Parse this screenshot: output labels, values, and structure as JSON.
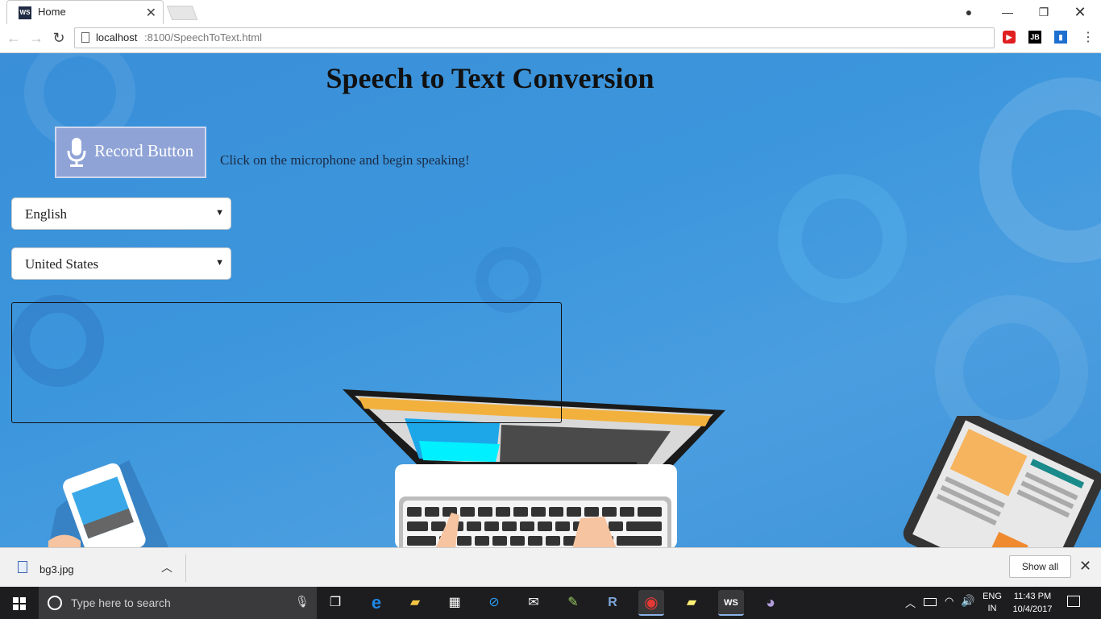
{
  "browser": {
    "tab_title": "Home",
    "tab_favicon_text": "WS",
    "tab_close": "✕",
    "url_host": "localhost",
    "url_path": ":8100/SpeechToText.html",
    "extensions": {
      "red_label": "▶",
      "jb_label": "JB",
      "blue_label": "▮"
    },
    "menu_glyph": "⋮",
    "window_controls": {
      "profile": "●",
      "minimize": "—",
      "maximize": "❐",
      "close": "✕"
    }
  },
  "page": {
    "title": "Speech to Text Conversion",
    "record_button_label": "Record Button",
    "instruction": "Click on the microphone and begin speaking!",
    "language_select": {
      "value": "English",
      "arrow": "▼"
    },
    "dialect_select": {
      "value": "United States",
      "arrow": "▼"
    },
    "transcript": ""
  },
  "download_bar": {
    "filename": "bg3.jpg",
    "chevron": "︿",
    "show_all_label": "Show all",
    "close_glyph": "✕"
  },
  "taskbar": {
    "search_placeholder": "Type here to search",
    "mic_glyph": "🎙",
    "apps": [
      {
        "name": "task-view",
        "glyph": "❐",
        "color": "#ffffff"
      },
      {
        "name": "edge",
        "glyph": "e",
        "color": "#1e88e5"
      },
      {
        "name": "file-explorer",
        "glyph": "▰",
        "color": "#f4c542"
      },
      {
        "name": "store",
        "glyph": "▦",
        "color": "#ffffff"
      },
      {
        "name": "safari",
        "glyph": "⊘",
        "color": "#2d9bf0"
      },
      {
        "name": "mail",
        "glyph": "✉",
        "color": "#ffffff"
      },
      {
        "name": "notepad-plus",
        "glyph": "✎",
        "color": "#9ccc65"
      },
      {
        "name": "r-studio",
        "glyph": "R",
        "color": "#7da7d9"
      },
      {
        "name": "chrome",
        "glyph": "◉",
        "color": "#e53935"
      },
      {
        "name": "sticky-notes",
        "glyph": "▰",
        "color": "#fff176"
      },
      {
        "name": "webstorm",
        "glyph": "WS",
        "color": "#ffffff"
      },
      {
        "name": "github-desktop",
        "glyph": "◕",
        "color": "#ffffff"
      }
    ],
    "tray": {
      "chevron": "︿",
      "wifi": "◠",
      "volume": "🔊"
    },
    "language_top": "ENG",
    "language_bottom": "IN",
    "time": "11:43 PM",
    "date": "10/4/2017"
  },
  "colors": {
    "page_background": "#3c96dc",
    "record_button": "#8fa3d6",
    "taskbar": "#1d1d1f"
  }
}
